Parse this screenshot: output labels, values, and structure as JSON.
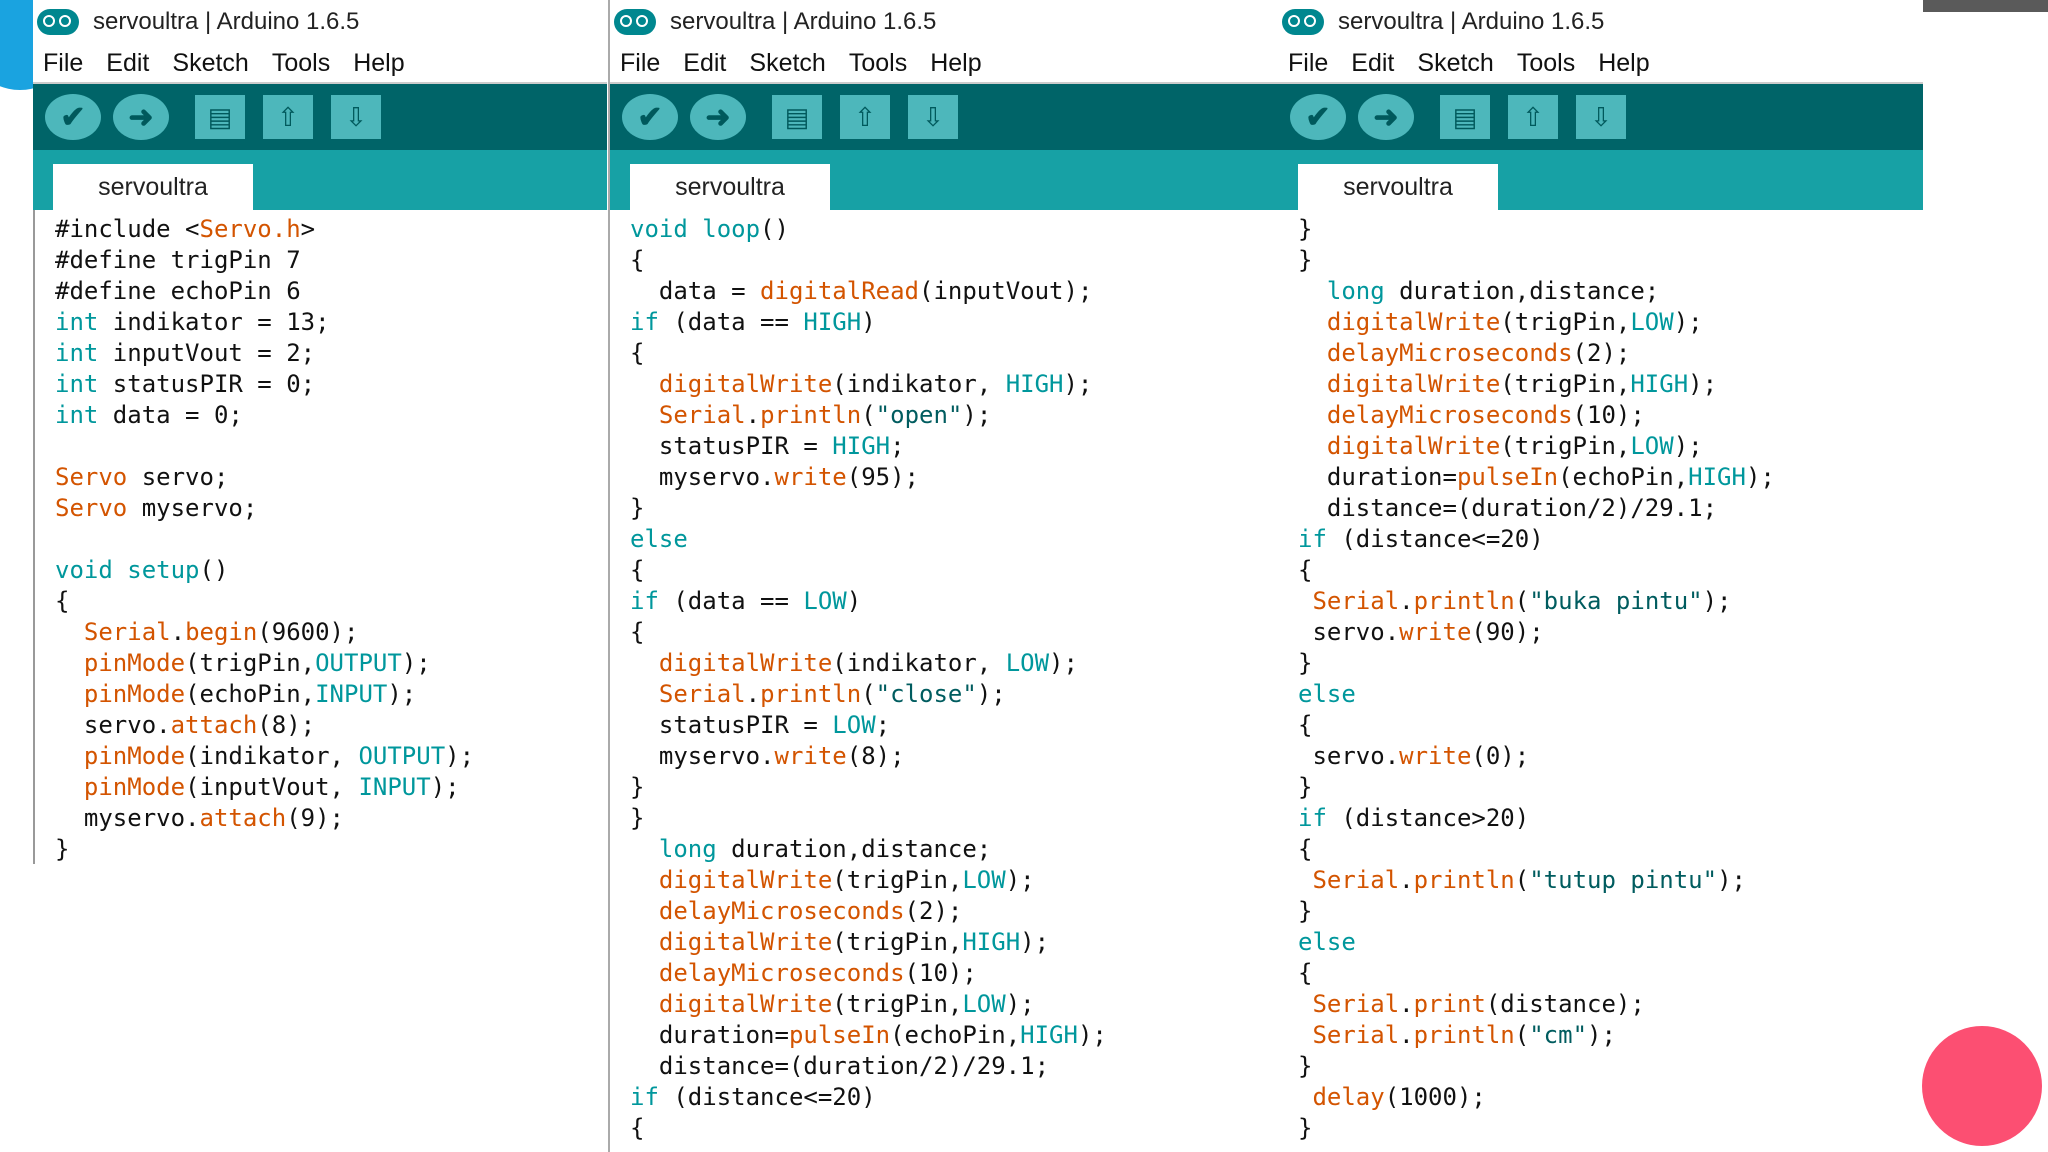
{
  "windows": [
    {
      "title": "servoultra | Arduino 1.6.5",
      "menu": [
        "File",
        "Edit",
        "Sketch",
        "Tools",
        "Help"
      ],
      "tab": "servoultra",
      "lines": [
        [
          [
            "pp",
            "#include <"
          ],
          [
            "kw-func",
            "Servo.h"
          ],
          [
            "pp",
            ">"
          ]
        ],
        [
          [
            "pp",
            "#define trigPin 7"
          ]
        ],
        [
          [
            "pp",
            "#define echoPin 6"
          ]
        ],
        [
          [
            "kw-type",
            "int"
          ],
          [
            "pp",
            " indikator = 13;"
          ]
        ],
        [
          [
            "kw-type",
            "int"
          ],
          [
            "pp",
            " inputVout = 2;"
          ]
        ],
        [
          [
            "kw-type",
            "int"
          ],
          [
            "pp",
            " statusPIR = 0;"
          ]
        ],
        [
          [
            "kw-type",
            "int"
          ],
          [
            "pp",
            " data = 0;"
          ]
        ],
        [
          [
            "pp",
            ""
          ]
        ],
        [
          [
            "kw-func",
            "Servo"
          ],
          [
            "pp",
            " servo;"
          ]
        ],
        [
          [
            "kw-func",
            "Servo"
          ],
          [
            "pp",
            " myservo;"
          ]
        ],
        [
          [
            "pp",
            ""
          ]
        ],
        [
          [
            "kw-type",
            "void"
          ],
          [
            "pp",
            " "
          ],
          [
            "kw-type",
            "setup"
          ],
          [
            "pp",
            "()"
          ]
        ],
        [
          [
            "pp",
            "{"
          ]
        ],
        [
          [
            "pp",
            "  "
          ],
          [
            "kw-func",
            "Serial"
          ],
          [
            "pp",
            "."
          ],
          [
            "kw-func",
            "begin"
          ],
          [
            "pp",
            "(9600);"
          ]
        ],
        [
          [
            "pp",
            "  "
          ],
          [
            "kw-func",
            "pinMode"
          ],
          [
            "pp",
            "(trigPin,"
          ],
          [
            "kw-const",
            "OUTPUT"
          ],
          [
            "pp",
            ");"
          ]
        ],
        [
          [
            "pp",
            "  "
          ],
          [
            "kw-func",
            "pinMode"
          ],
          [
            "pp",
            "(echoPin,"
          ],
          [
            "kw-const",
            "INPUT"
          ],
          [
            "pp",
            ");"
          ]
        ],
        [
          [
            "pp",
            "  servo."
          ],
          [
            "kw-func",
            "attach"
          ],
          [
            "pp",
            "(8);"
          ]
        ],
        [
          [
            "pp",
            "  "
          ],
          [
            "kw-func",
            "pinMode"
          ],
          [
            "pp",
            "(indikator, "
          ],
          [
            "kw-const",
            "OUTPUT"
          ],
          [
            "pp",
            ");"
          ]
        ],
        [
          [
            "pp",
            "  "
          ],
          [
            "kw-func",
            "pinMode"
          ],
          [
            "pp",
            "(inputVout, "
          ],
          [
            "kw-const",
            "INPUT"
          ],
          [
            "pp",
            ");"
          ]
        ],
        [
          [
            "pp",
            "  myservo."
          ],
          [
            "kw-func",
            "attach"
          ],
          [
            "pp",
            "(9);"
          ]
        ],
        [
          [
            "pp",
            "}"
          ]
        ]
      ]
    },
    {
      "title": "servoultra | Arduino 1.6.5",
      "menu": [
        "File",
        "Edit",
        "Sketch",
        "Tools",
        "Help"
      ],
      "tab": "servoultra",
      "lines": [
        [
          [
            "kw-type",
            "void"
          ],
          [
            "pp",
            " "
          ],
          [
            "kw-type",
            "loop"
          ],
          [
            "pp",
            "()"
          ]
        ],
        [
          [
            "pp",
            "{"
          ]
        ],
        [
          [
            "pp",
            "  data = "
          ],
          [
            "kw-func",
            "digitalRead"
          ],
          [
            "pp",
            "(inputVout);"
          ]
        ],
        [
          [
            "kw-type",
            "if"
          ],
          [
            "pp",
            " (data == "
          ],
          [
            "kw-const",
            "HIGH"
          ],
          [
            "pp",
            ")"
          ]
        ],
        [
          [
            "pp",
            "{"
          ]
        ],
        [
          [
            "pp",
            "  "
          ],
          [
            "kw-func",
            "digitalWrite"
          ],
          [
            "pp",
            "(indikator, "
          ],
          [
            "kw-const",
            "HIGH"
          ],
          [
            "pp",
            ");"
          ]
        ],
        [
          [
            "pp",
            "  "
          ],
          [
            "kw-func",
            "Serial"
          ],
          [
            "pp",
            "."
          ],
          [
            "kw-func",
            "println"
          ],
          [
            "pp",
            "("
          ],
          [
            "str",
            "\"open\""
          ],
          [
            "pp",
            ");"
          ]
        ],
        [
          [
            "pp",
            "  statusPIR = "
          ],
          [
            "kw-const",
            "HIGH"
          ],
          [
            "pp",
            ";"
          ]
        ],
        [
          [
            "pp",
            "  myservo."
          ],
          [
            "kw-func",
            "write"
          ],
          [
            "pp",
            "(95);"
          ]
        ],
        [
          [
            "pp",
            "}"
          ]
        ],
        [
          [
            "kw-type",
            "else"
          ]
        ],
        [
          [
            "pp",
            "{"
          ]
        ],
        [
          [
            "kw-type",
            "if"
          ],
          [
            "pp",
            " (data == "
          ],
          [
            "kw-const",
            "LOW"
          ],
          [
            "pp",
            ")"
          ]
        ],
        [
          [
            "pp",
            "{"
          ]
        ],
        [
          [
            "pp",
            "  "
          ],
          [
            "kw-func",
            "digitalWrite"
          ],
          [
            "pp",
            "(indikator, "
          ],
          [
            "kw-const",
            "LOW"
          ],
          [
            "pp",
            ");"
          ]
        ],
        [
          [
            "pp",
            "  "
          ],
          [
            "kw-func",
            "Serial"
          ],
          [
            "pp",
            "."
          ],
          [
            "kw-func",
            "println"
          ],
          [
            "pp",
            "("
          ],
          [
            "str",
            "\"close\""
          ],
          [
            "pp",
            ");"
          ]
        ],
        [
          [
            "pp",
            "  statusPIR = "
          ],
          [
            "kw-const",
            "LOW"
          ],
          [
            "pp",
            ";"
          ]
        ],
        [
          [
            "pp",
            "  myservo."
          ],
          [
            "kw-func",
            "write"
          ],
          [
            "pp",
            "(8);"
          ]
        ],
        [
          [
            "pp",
            "}"
          ]
        ],
        [
          [
            "pp",
            "}"
          ]
        ],
        [
          [
            "pp",
            "  "
          ],
          [
            "kw-type",
            "long"
          ],
          [
            "pp",
            " duration,distance;"
          ]
        ],
        [
          [
            "pp",
            "  "
          ],
          [
            "kw-func",
            "digitalWrite"
          ],
          [
            "pp",
            "(trigPin,"
          ],
          [
            "kw-const",
            "LOW"
          ],
          [
            "pp",
            ");"
          ]
        ],
        [
          [
            "pp",
            "  "
          ],
          [
            "kw-func",
            "delayMicroseconds"
          ],
          [
            "pp",
            "(2);"
          ]
        ],
        [
          [
            "pp",
            "  "
          ],
          [
            "kw-func",
            "digitalWrite"
          ],
          [
            "pp",
            "(trigPin,"
          ],
          [
            "kw-const",
            "HIGH"
          ],
          [
            "pp",
            ");"
          ]
        ],
        [
          [
            "pp",
            "  "
          ],
          [
            "kw-func",
            "delayMicroseconds"
          ],
          [
            "pp",
            "(10);"
          ]
        ],
        [
          [
            "pp",
            "  "
          ],
          [
            "kw-func",
            "digitalWrite"
          ],
          [
            "pp",
            "(trigPin,"
          ],
          [
            "kw-const",
            "LOW"
          ],
          [
            "pp",
            ");"
          ]
        ],
        [
          [
            "pp",
            "  duration="
          ],
          [
            "kw-func",
            "pulseIn"
          ],
          [
            "pp",
            "(echoPin,"
          ],
          [
            "kw-const",
            "HIGH"
          ],
          [
            "pp",
            ");"
          ]
        ],
        [
          [
            "pp",
            "  distance=(duration/2)/29.1;"
          ]
        ],
        [
          [
            "kw-type",
            "if"
          ],
          [
            "pp",
            " (distance<=20)"
          ]
        ],
        [
          [
            "pp",
            "{"
          ]
        ]
      ]
    },
    {
      "title": "servoultra | Arduino 1.6.5",
      "menu": [
        "File",
        "Edit",
        "Sketch",
        "Tools",
        "Help"
      ],
      "tab": "servoultra",
      "lines": [
        [
          [
            "pp",
            "}"
          ]
        ],
        [
          [
            "pp",
            "}"
          ]
        ],
        [
          [
            "pp",
            "  "
          ],
          [
            "kw-type",
            "long"
          ],
          [
            "pp",
            " duration,distance;"
          ]
        ],
        [
          [
            "pp",
            "  "
          ],
          [
            "kw-func",
            "digitalWrite"
          ],
          [
            "pp",
            "(trigPin,"
          ],
          [
            "kw-const",
            "LOW"
          ],
          [
            "pp",
            ");"
          ]
        ],
        [
          [
            "pp",
            "  "
          ],
          [
            "kw-func",
            "delayMicroseconds"
          ],
          [
            "pp",
            "(2);"
          ]
        ],
        [
          [
            "pp",
            "  "
          ],
          [
            "kw-func",
            "digitalWrite"
          ],
          [
            "pp",
            "(trigPin,"
          ],
          [
            "kw-const",
            "HIGH"
          ],
          [
            "pp",
            ");"
          ]
        ],
        [
          [
            "pp",
            "  "
          ],
          [
            "kw-func",
            "delayMicroseconds"
          ],
          [
            "pp",
            "(10);"
          ]
        ],
        [
          [
            "pp",
            "  "
          ],
          [
            "kw-func",
            "digitalWrite"
          ],
          [
            "pp",
            "(trigPin,"
          ],
          [
            "kw-const",
            "LOW"
          ],
          [
            "pp",
            ");"
          ]
        ],
        [
          [
            "pp",
            "  duration="
          ],
          [
            "kw-func",
            "pulseIn"
          ],
          [
            "pp",
            "(echoPin,"
          ],
          [
            "kw-const",
            "HIGH"
          ],
          [
            "pp",
            ");"
          ]
        ],
        [
          [
            "pp",
            "  distance=(duration/2)/29.1;"
          ]
        ],
        [
          [
            "kw-type",
            "if"
          ],
          [
            "pp",
            " (distance<=20)"
          ]
        ],
        [
          [
            "pp",
            "{"
          ]
        ],
        [
          [
            "pp",
            " "
          ],
          [
            "kw-func",
            "Serial"
          ],
          [
            "pp",
            "."
          ],
          [
            "kw-func",
            "println"
          ],
          [
            "pp",
            "("
          ],
          [
            "str",
            "\"buka pintu\""
          ],
          [
            "pp",
            ");"
          ]
        ],
        [
          [
            "pp",
            " servo."
          ],
          [
            "kw-func",
            "write"
          ],
          [
            "pp",
            "(90);"
          ]
        ],
        [
          [
            "pp",
            "}"
          ]
        ],
        [
          [
            "kw-type",
            "else"
          ]
        ],
        [
          [
            "pp",
            "{"
          ]
        ],
        [
          [
            "pp",
            " servo."
          ],
          [
            "kw-func",
            "write"
          ],
          [
            "pp",
            "(0);"
          ]
        ],
        [
          [
            "pp",
            "}"
          ]
        ],
        [
          [
            "kw-type",
            "if"
          ],
          [
            "pp",
            " (distance>20)"
          ]
        ],
        [
          [
            "pp",
            "{"
          ]
        ],
        [
          [
            "pp",
            " "
          ],
          [
            "kw-func",
            "Serial"
          ],
          [
            "pp",
            "."
          ],
          [
            "kw-func",
            "println"
          ],
          [
            "pp",
            "("
          ],
          [
            "str",
            "\"tutup pintu\""
          ],
          [
            "pp",
            ");"
          ]
        ],
        [
          [
            "pp",
            "}"
          ]
        ],
        [
          [
            "kw-type",
            "else"
          ]
        ],
        [
          [
            "pp",
            "{"
          ]
        ],
        [
          [
            "pp",
            " "
          ],
          [
            "kw-func",
            "Serial"
          ],
          [
            "pp",
            "."
          ],
          [
            "kw-func",
            "print"
          ],
          [
            "pp",
            "(distance);"
          ]
        ],
        [
          [
            "pp",
            " "
          ],
          [
            "kw-func",
            "Serial"
          ],
          [
            "pp",
            "."
          ],
          [
            "kw-func",
            "println"
          ],
          [
            "pp",
            "("
          ],
          [
            "str",
            "\"cm\""
          ],
          [
            "pp",
            ");"
          ]
        ],
        [
          [
            "pp",
            "}"
          ]
        ],
        [
          [
            "pp",
            " "
          ],
          [
            "kw-func",
            "delay"
          ],
          [
            "pp",
            "(1000);"
          ]
        ],
        [
          [
            "pp",
            "}"
          ]
        ]
      ]
    }
  ],
  "toolbar_icons": [
    "verify-icon",
    "upload-icon",
    "new-icon",
    "open-icon",
    "save-icon"
  ],
  "colors": {
    "toolbar": "#006468",
    "tabbar": "#17a1a5",
    "button": "#4db7bb",
    "keyword": "#00979c",
    "function": "#d35400"
  }
}
